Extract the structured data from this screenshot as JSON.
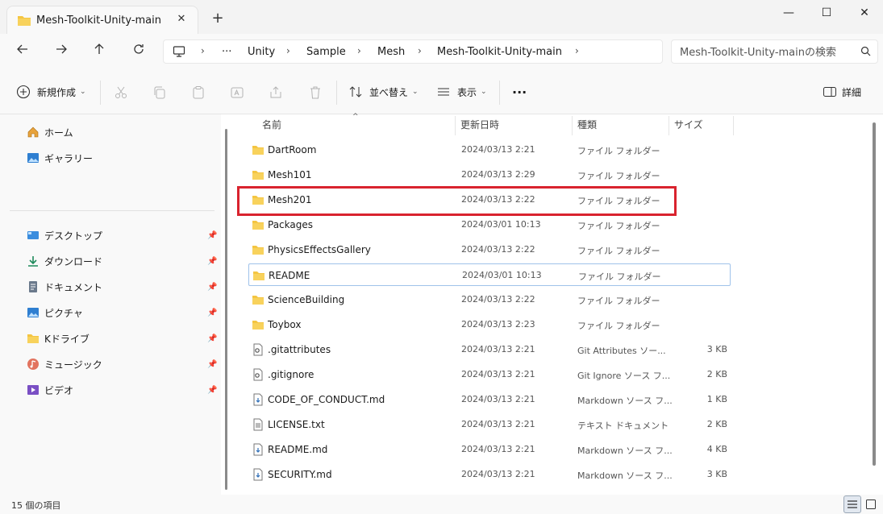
{
  "window": {
    "tab_title": "Mesh-Toolkit-Unity-main",
    "tab_close": "✕",
    "new_tab": "+",
    "minimize": "—",
    "maximize": "☐",
    "close": "✕"
  },
  "address_bar": {
    "overflow": "···",
    "separator": "›",
    "breadcrumbs": [
      "Unity",
      "Sample",
      "Mesh",
      "Mesh-Toolkit-Unity-main"
    ],
    "search_placeholder": "Mesh-Toolkit-Unity-mainの検索"
  },
  "toolbar": {
    "new_label": "新規作成",
    "sort_label": "並べ替え",
    "view_label": "表示",
    "more_label": "···",
    "details_label": "詳細",
    "chevron": "⌄"
  },
  "sidebar": {
    "pin": "📌",
    "top_items": [
      {
        "label": "ホーム",
        "icon": "home-icon"
      },
      {
        "label": "ギャラリー",
        "icon": "gallery-icon"
      }
    ],
    "quick_access": [
      {
        "label": "デスクトップ",
        "icon": "desktop-icon"
      },
      {
        "label": "ダウンロード",
        "icon": "download-icon"
      },
      {
        "label": "ドキュメント",
        "icon": "document-icon"
      },
      {
        "label": "ピクチャ",
        "icon": "pictures-icon"
      },
      {
        "label": "Kドライブ",
        "icon": "folder-icon"
      },
      {
        "label": "ミュージック",
        "icon": "music-icon"
      },
      {
        "label": "ビデオ",
        "icon": "video-icon"
      }
    ]
  },
  "file_list": {
    "columns": {
      "name": "名前",
      "date": "更新日時",
      "type": "種類",
      "size": "サイズ"
    },
    "sort_indicator": "^",
    "rows": [
      {
        "name": "DartRoom",
        "date": "2024/03/13 2:21",
        "type": "ファイル フォルダー",
        "size": "",
        "kind": "folder"
      },
      {
        "name": "Mesh101",
        "date": "2024/03/13 2:29",
        "type": "ファイル フォルダー",
        "size": "",
        "kind": "folder"
      },
      {
        "name": "Mesh201",
        "date": "2024/03/13 2:22",
        "type": "ファイル フォルダー",
        "size": "",
        "kind": "folder"
      },
      {
        "name": "Packages",
        "date": "2024/03/01 10:13",
        "type": "ファイル フォルダー",
        "size": "",
        "kind": "folder"
      },
      {
        "name": "PhysicsEffectsGallery",
        "date": "2024/03/13 2:22",
        "type": "ファイル フォルダー",
        "size": "",
        "kind": "folder"
      },
      {
        "name": "README",
        "date": "2024/03/01 10:13",
        "type": "ファイル フォルダー",
        "size": "",
        "kind": "folder"
      },
      {
        "name": "ScienceBuilding",
        "date": "2024/03/13 2:22",
        "type": "ファイル フォルダー",
        "size": "",
        "kind": "folder"
      },
      {
        "name": "Toybox",
        "date": "2024/03/13 2:23",
        "type": "ファイル フォルダー",
        "size": "",
        "kind": "folder"
      },
      {
        "name": ".gitattributes",
        "date": "2024/03/13 2:21",
        "type": "Git Attributes ソー...",
        "size": "3 KB",
        "kind": "config"
      },
      {
        "name": ".gitignore",
        "date": "2024/03/13 2:21",
        "type": "Git Ignore ソース フ...",
        "size": "2 KB",
        "kind": "config"
      },
      {
        "name": "CODE_OF_CONDUCT.md",
        "date": "2024/03/13 2:21",
        "type": "Markdown ソース フ...",
        "size": "1 KB",
        "kind": "markdown"
      },
      {
        "name": "LICENSE.txt",
        "date": "2024/03/13 2:21",
        "type": "テキスト ドキュメント",
        "size": "2 KB",
        "kind": "text"
      },
      {
        "name": "README.md",
        "date": "2024/03/13 2:21",
        "type": "Markdown ソース フ...",
        "size": "4 KB",
        "kind": "markdown"
      },
      {
        "name": "SECURITY.md",
        "date": "2024/03/13 2:21",
        "type": "Markdown ソース フ...",
        "size": "3 KB",
        "kind": "markdown"
      }
    ]
  },
  "status_bar": {
    "item_count": "15 個の項目"
  },
  "colors": {
    "folder": "#f4c542",
    "highlight": "#d9232e",
    "focus_border": "#9fc2ea"
  }
}
